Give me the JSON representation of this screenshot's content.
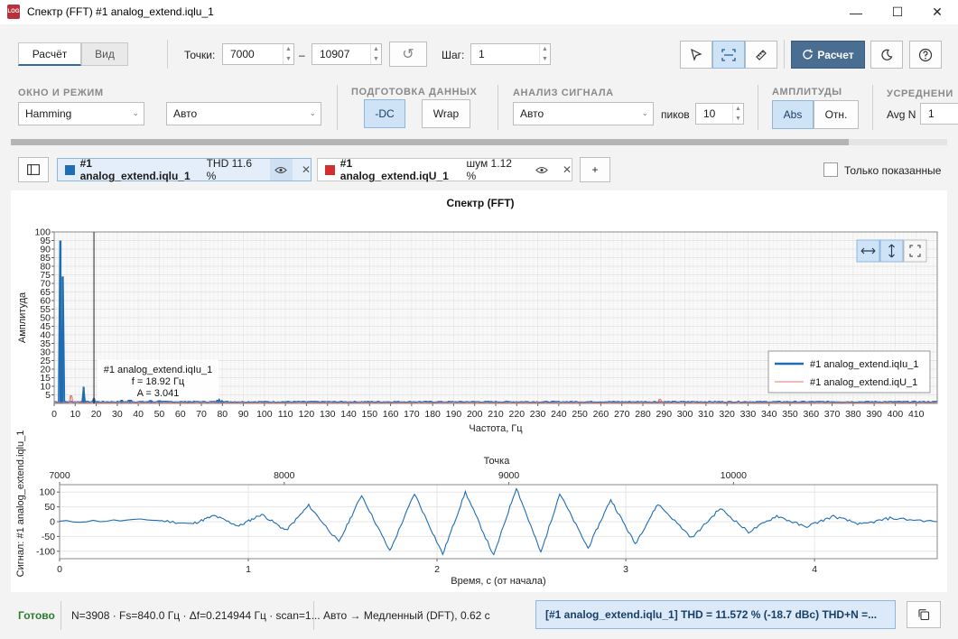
{
  "window": {
    "title": "Спектр (FFT) #1 analog_extend.iqlu_1",
    "icon_text": "LOG",
    "controls": {
      "minimize": "—",
      "maximize": "☐",
      "close": "✕"
    }
  },
  "toolbar": {
    "tabs": [
      {
        "label": "Расчёт"
      },
      {
        "label": "Вид"
      }
    ],
    "points_label": "Точки:",
    "points_from": "7000",
    "points_dash": "–",
    "points_to": "10907",
    "step_label": "Шаг:",
    "step_value": "1",
    "calc_label": "Расчет"
  },
  "groups": {
    "window_mode": {
      "title": "ОКНО И РЕЖИМ",
      "window_value": "Hamming",
      "mode_value": "Авто"
    },
    "prep": {
      "title": "ПОДГОТОВКА ДАННЫХ",
      "dc_label": "-DC",
      "wrap_label": "Wrap"
    },
    "analysis": {
      "title": "АНАЛИЗ СИГНАЛА",
      "method_value": "Авто",
      "peaks_label": "пиков",
      "peaks_value": "10"
    },
    "amplitudes": {
      "title": "АМПЛИТУДЫ",
      "abs_label": "Abs",
      "rel_label": "Отн."
    },
    "averaging": {
      "title": "УСРЕДНЕНИ",
      "avg_label": "Avg N",
      "avg_value": "1"
    }
  },
  "series_tabs": [
    {
      "name": "#1 analog_extend.iqlu_1",
      "info": "THD 11.6 %",
      "color": "#1f6db3"
    },
    {
      "name": "#1 analog_extend.iqU_1",
      "info": "шум 1.12 %",
      "color": "#d32f2f"
    }
  ],
  "add_tab_label": "+",
  "only_shown_label": "Только показанные",
  "chart_data": [
    {
      "type": "line",
      "title": "Спектр (FFT)",
      "xlabel": "Частота, Гц",
      "ylabel": "Амплитуда",
      "xlim": [
        0,
        420
      ],
      "ylim": [
        0,
        100
      ],
      "x_ticks": [
        0,
        10,
        20,
        30,
        40,
        50,
        60,
        70,
        80,
        90,
        100,
        110,
        120,
        130,
        140,
        150,
        160,
        170,
        180,
        190,
        200,
        210,
        220,
        230,
        240,
        250,
        260,
        270,
        280,
        290,
        300,
        310,
        320,
        330,
        340,
        350,
        360,
        370,
        380,
        390,
        400,
        410
      ],
      "y_ticks": [
        5,
        10,
        15,
        20,
        25,
        30,
        35,
        40,
        45,
        50,
        55,
        60,
        65,
        70,
        75,
        80,
        85,
        90,
        95,
        100
      ],
      "grid": true,
      "legend_position": "bottom-right",
      "series": [
        {
          "name": "#1 analog_extend.iqIu_1",
          "color": "#1f6db3",
          "peaks": [
            [
              3,
              95
            ],
            [
              4,
              74
            ],
            [
              14,
              9.7
            ],
            [
              18.92,
              3.041
            ],
            [
              32,
              2.2
            ],
            [
              36,
              2.6
            ],
            [
              46,
              1.6
            ],
            [
              50,
              1.4
            ],
            [
              64,
              1.0
            ],
            [
              78,
              2.4
            ],
            [
              80,
              1.6
            ]
          ]
        },
        {
          "name": "#1 analog_extend.iqU_1",
          "color": "#e57373",
          "peaks": [
            [
              8,
              4.5
            ],
            [
              288,
              2.5
            ]
          ]
        }
      ],
      "cursor": {
        "series": "#1 analog_extend.iqIu_1",
        "f_label": "f = 18.92 Гц",
        "a_label": "A = 3.041",
        "x": 18.92
      }
    },
    {
      "type": "line",
      "xlabel": "Время, с (от начала)",
      "ylabel": "Сигнал: #1 analog_extend.iqlu_1",
      "top_axis_label": "Точка",
      "xlim": [
        0,
        4.65
      ],
      "ylim": [
        -125,
        125
      ],
      "x_ticks": [
        0,
        1,
        2,
        3,
        4
      ],
      "y_ticks": [
        100,
        50,
        0,
        -50,
        -100
      ],
      "top_ticks": [
        7000,
        8000,
        9000,
        10000
      ],
      "top_range": [
        7000,
        10907
      ],
      "grid": true,
      "series": [
        {
          "name": "#1 analog_extend.iqlu_1",
          "color": "#1f6db3",
          "envelope": [
            [
              0,
              0
            ],
            [
              0.5,
              6
            ],
            [
              0.8,
              0
            ],
            [
              1.05,
              -25
            ],
            [
              1.3,
              -15
            ],
            [
              1.6,
              -45
            ],
            [
              1.9,
              -75
            ],
            [
              2.2,
              -100
            ],
            [
              2.45,
              -110
            ],
            [
              2.7,
              -90
            ],
            [
              3.0,
              -60
            ],
            [
              3.3,
              -40
            ],
            [
              3.6,
              -22
            ],
            [
              4.0,
              -10
            ],
            [
              4.4,
              -4
            ],
            [
              4.65,
              0
            ]
          ],
          "peaks": [
            [
              0.5,
              6
            ],
            [
              0.82,
              20
            ],
            [
              1.07,
              25
            ],
            [
              1.32,
              55
            ],
            [
              1.6,
              90
            ],
            [
              1.88,
              95
            ],
            [
              2.15,
              100
            ],
            [
              2.42,
              115
            ],
            [
              2.65,
              95
            ],
            [
              2.92,
              75
            ],
            [
              3.17,
              60
            ],
            [
              3.5,
              45
            ],
            [
              3.8,
              20
            ],
            [
              4.1,
              18
            ],
            [
              4.4,
              12
            ]
          ],
          "troughs": [
            [
              0.7,
              -8
            ],
            [
              0.95,
              -15
            ],
            [
              1.2,
              -30
            ],
            [
              1.48,
              -70
            ],
            [
              1.75,
              -100
            ],
            [
              2.03,
              -110
            ],
            [
              2.3,
              -115
            ],
            [
              2.55,
              -105
            ],
            [
              2.8,
              -90
            ],
            [
              3.05,
              -75
            ],
            [
              3.35,
              -55
            ],
            [
              3.65,
              -35
            ],
            [
              3.95,
              -18
            ],
            [
              4.25,
              -10
            ]
          ]
        }
      ]
    }
  ],
  "status": {
    "ready": "Готово",
    "info": "N=3908 · Fs=840.0 Гц · Δf=0.214944 Гц · scan=1...",
    "mode": "Авто → Медленный (DFT), 0.62 с",
    "result": "[#1 analog_extend.iqlu_1]  THD = 11.572 %  (-18.7 dBc)   THD+N =..."
  }
}
